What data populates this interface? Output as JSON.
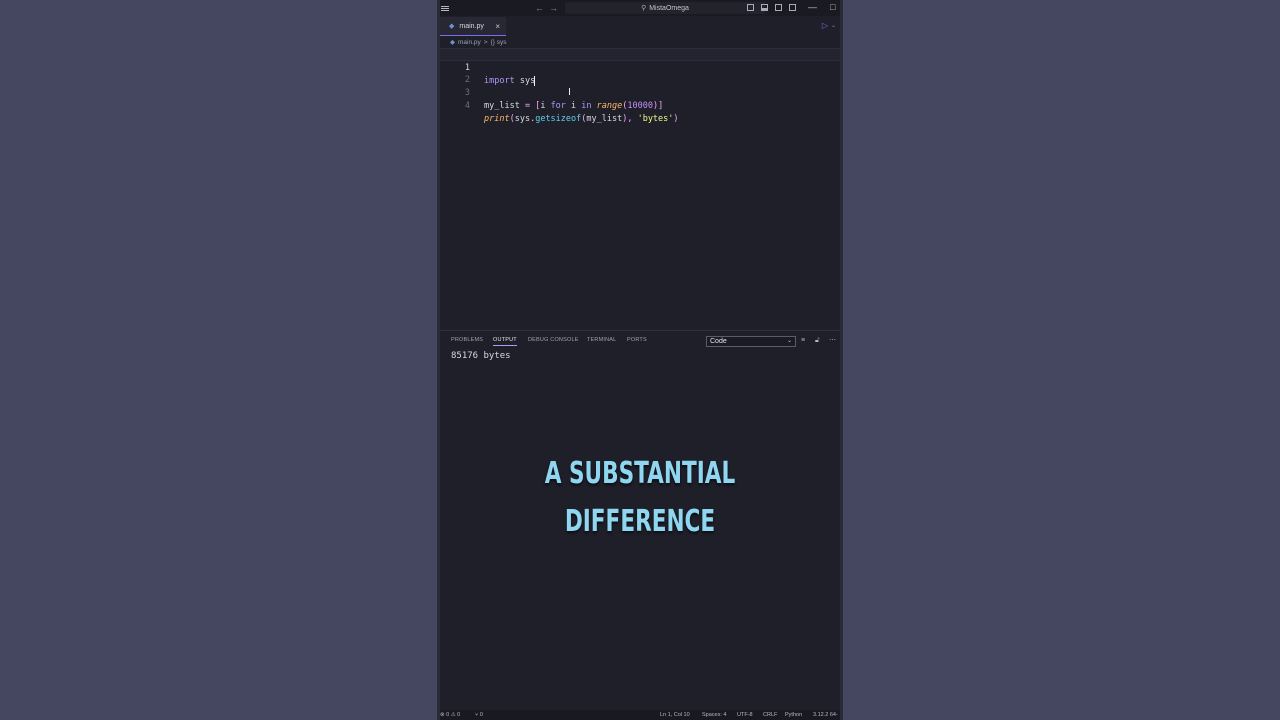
{
  "titlebar": {
    "search_text": "MistaOmega",
    "back_arrow": "←",
    "forward_arrow": "→",
    "minimize": "—",
    "maximize": "□",
    "icons": [
      "menu-icon",
      "search-icon",
      "toggle-sidebar-icon",
      "toggle-panel-icon",
      "toggle-secondary-sidebar-icon",
      "customize-layout-icon"
    ]
  },
  "tab": {
    "filename": "main.py",
    "close": "×",
    "file_icon_glyph": "◆"
  },
  "run": {
    "play": "▷",
    "chevron": "⌄"
  },
  "breadcrumb": {
    "file": "main.py",
    "separator": ">",
    "symbol": "{} sys"
  },
  "editor": {
    "line_numbers": [
      "1",
      "2",
      "3",
      "4"
    ],
    "line1": {
      "kw": "import",
      "name": "sys"
    },
    "line3": {
      "var": "my_list",
      "op": " = [",
      "i1": "i ",
      "for": "for",
      "i2": " i ",
      "in": "in",
      "fn": "range",
      "p1": "(",
      "num": "10000",
      "p2": ")]"
    },
    "line4": {
      "fn": "print",
      "p1": "(",
      "mod": "sys",
      "dot": ".",
      "meth": "getsizeof",
      "p2": "(",
      "arg": "my_list",
      "p3": "), ",
      "str": "'bytes'",
      "p4": ")"
    }
  },
  "panel": {
    "tabs": [
      "PROBLEMS",
      "OUTPUT",
      "DEBUG CONSOLE",
      "TERMINAL",
      "PORTS"
    ],
    "active_tab": "OUTPUT",
    "select_value": "Code",
    "output": "85176 bytes"
  },
  "caption": {
    "line1": "A SUBSTANTIAL",
    "line2": "DIFFERENCE"
  },
  "statusbar": {
    "errors": "⊗ 0 ⚠ 0",
    "ports": "⑂ 0",
    "position": "Ln 1, Col 10",
    "spaces": "Spaces: 4",
    "encoding": "UTF-8",
    "eol": "CRLF",
    "language": "Python",
    "interpreter": "3.12.2 64-"
  },
  "colors": {
    "page_bg": "#44475f",
    "editor_bg": "#1e1f29",
    "caption": "#8fd7f1",
    "accent": "#7c6cf0"
  }
}
